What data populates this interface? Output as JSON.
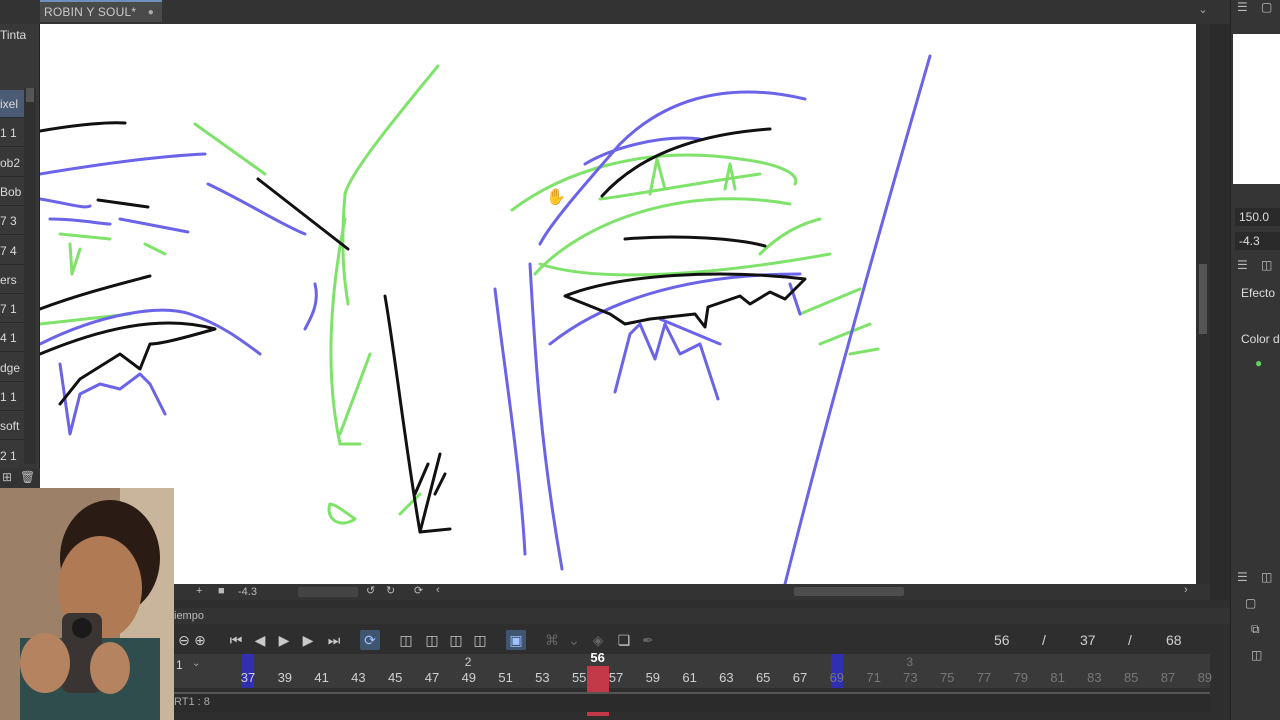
{
  "document": {
    "tab_title": "ROBIN Y SOUL*",
    "tab_modified_dot": "●"
  },
  "left_panel": {
    "header_label": "Tinta",
    "layers": [
      {
        "label": "ixel",
        "selected": true
      },
      {
        "label": "1 1",
        "selected": false
      },
      {
        "label": "ob2",
        "selected": false
      },
      {
        "label": "Bob",
        "selected": false
      },
      {
        "label": "7 3",
        "selected": false
      },
      {
        "label": "7 4",
        "selected": false
      },
      {
        "label": "ers",
        "selected": false
      },
      {
        "label": "7 1",
        "selected": false
      },
      {
        "label": "4 1",
        "selected": false
      },
      {
        "label": "dge",
        "selected": false
      },
      {
        "label": "1 1",
        "selected": false
      },
      {
        "label": "soft",
        "selected": false
      },
      {
        "label": "2 1",
        "selected": false
      }
    ]
  },
  "canvas": {
    "stroke_colors": {
      "black": "#111111",
      "blue": "#6b63e8",
      "green": "#7fe36b"
    }
  },
  "canvas_status": {
    "zoom": "-4.3"
  },
  "right_panel": {
    "scale_value": "150.0",
    "rotation_value": "-4.3",
    "effect_label": "Efecto",
    "color_label": "Color d"
  },
  "timeline": {
    "tab_label": "iempo",
    "current_frame": "56",
    "separator": "/",
    "range_start": "37",
    "range_end": "68",
    "second_marks": [
      {
        "label": "2",
        "frame": 49
      },
      {
        "label": "3",
        "frame": 73
      }
    ],
    "track_label": "RT1 : 8",
    "track_row_label": "1",
    "frames": [
      37,
      39,
      41,
      43,
      45,
      47,
      49,
      51,
      53,
      55,
      57,
      59,
      61,
      63,
      65,
      67,
      69,
      71,
      73,
      75,
      77,
      79,
      81,
      83,
      85,
      87,
      89
    ],
    "playhead_frame": 56,
    "range_marks": [
      37,
      69
    ]
  }
}
